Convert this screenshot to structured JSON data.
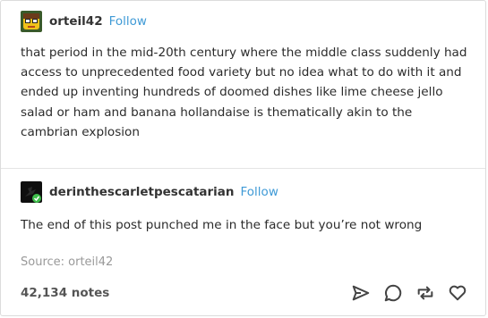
{
  "post": {
    "username": "orteil42",
    "follow_label": "Follow",
    "body": "that period in the mid-20th century where the middle class suddenly had access to unprecedented food variety but no idea what to do with it and ended up inventing hundreds of doomed dishes like lime cheese jello salad or ham and banana hollandaise is thematically akin to the cambrian explosion"
  },
  "reply": {
    "username": "derinthescarletpescatarian",
    "follow_label": "Follow",
    "body": "The end of this post punched me in the face but you’re not wrong"
  },
  "source": "Source: orteil42",
  "footer": {
    "notes": "42,134 notes",
    "icons": [
      "share-icon",
      "reply-icon",
      "reblog-icon",
      "like-icon"
    ]
  },
  "colors": {
    "follow": "#3f9ad6",
    "source": "#999999",
    "text": "#2b2b2b"
  }
}
